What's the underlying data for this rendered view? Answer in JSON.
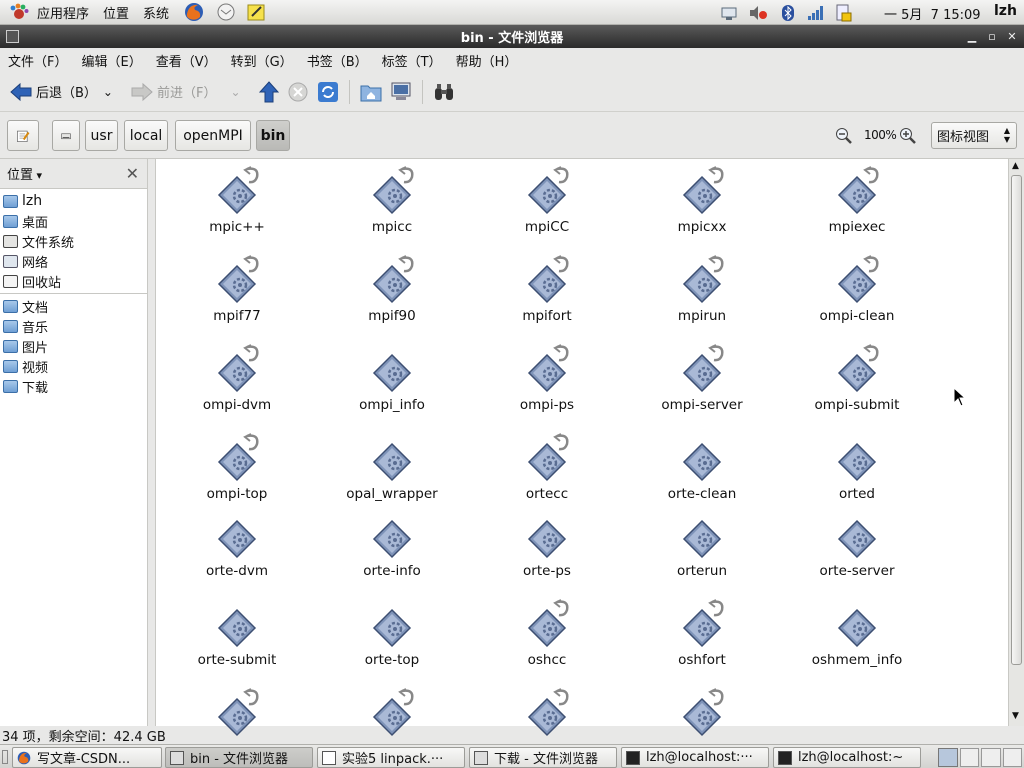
{
  "top_panel": {
    "menus": [
      "应用程序",
      "位置",
      "系统"
    ],
    "clock": "一 5月  7 15:09",
    "user": "lzh"
  },
  "window": {
    "title": "bin - 文件浏览器"
  },
  "menubar": [
    "文件（F）",
    "编辑（E）",
    "查看（V）",
    "转到（G）",
    "书签（B）",
    "标签（T）",
    "帮助（H）"
  ],
  "toolbar": {
    "back": "后退（B）",
    "forward": "前进（F）"
  },
  "breadcrumbs": [
    "usr",
    "local",
    "openMPI",
    "bin"
  ],
  "zoom": {
    "level": "100%"
  },
  "view_mode": "图标视图",
  "sidebar": {
    "header": "位置",
    "groups": [
      [
        "lzh",
        "桌面",
        "文件系统",
        "网络",
        "回收站"
      ],
      [
        "文档",
        "音乐",
        "图片",
        "视频",
        "下载"
      ]
    ]
  },
  "files": [
    {
      "name": "mpic++",
      "link": true
    },
    {
      "name": "mpicc",
      "link": true
    },
    {
      "name": "mpiCC",
      "link": true
    },
    {
      "name": "mpicxx",
      "link": true
    },
    {
      "name": "mpiexec",
      "link": true
    },
    {
      "name": "mpif77",
      "link": true
    },
    {
      "name": "mpif90",
      "link": true
    },
    {
      "name": "mpifort",
      "link": true
    },
    {
      "name": "mpirun",
      "link": true
    },
    {
      "name": "ompi-clean",
      "link": true
    },
    {
      "name": "ompi-dvm",
      "link": true
    },
    {
      "name": "ompi_info",
      "link": false
    },
    {
      "name": "ompi-ps",
      "link": true
    },
    {
      "name": "ompi-server",
      "link": true
    },
    {
      "name": "ompi-submit",
      "link": true
    },
    {
      "name": "ompi-top",
      "link": true
    },
    {
      "name": "opal_wrapper",
      "link": false
    },
    {
      "name": "ortecc",
      "link": true
    },
    {
      "name": "orte-clean",
      "link": false
    },
    {
      "name": "orted",
      "link": false
    },
    {
      "name": "orte-dvm",
      "link": false
    },
    {
      "name": "orte-info",
      "link": false
    },
    {
      "name": "orte-ps",
      "link": false
    },
    {
      "name": "orterun",
      "link": false
    },
    {
      "name": "orte-server",
      "link": false
    },
    {
      "name": "orte-submit",
      "link": false
    },
    {
      "name": "orte-top",
      "link": false
    },
    {
      "name": "oshcc",
      "link": true
    },
    {
      "name": "oshfort",
      "link": true
    },
    {
      "name": "oshmem_info",
      "link": false
    },
    {
      "name": "",
      "link": true
    },
    {
      "name": "",
      "link": true
    },
    {
      "name": "",
      "link": true
    },
    {
      "name": "",
      "link": true
    }
  ],
  "status": "34 项，剩余空间：42.4 GB",
  "taskbar": [
    "写文章-CSDN...",
    "bin - 文件浏览器",
    "实验5  linpack.···",
    "下载 - 文件浏览器",
    "lzh@localhost:···",
    "lzh@localhost:~"
  ]
}
